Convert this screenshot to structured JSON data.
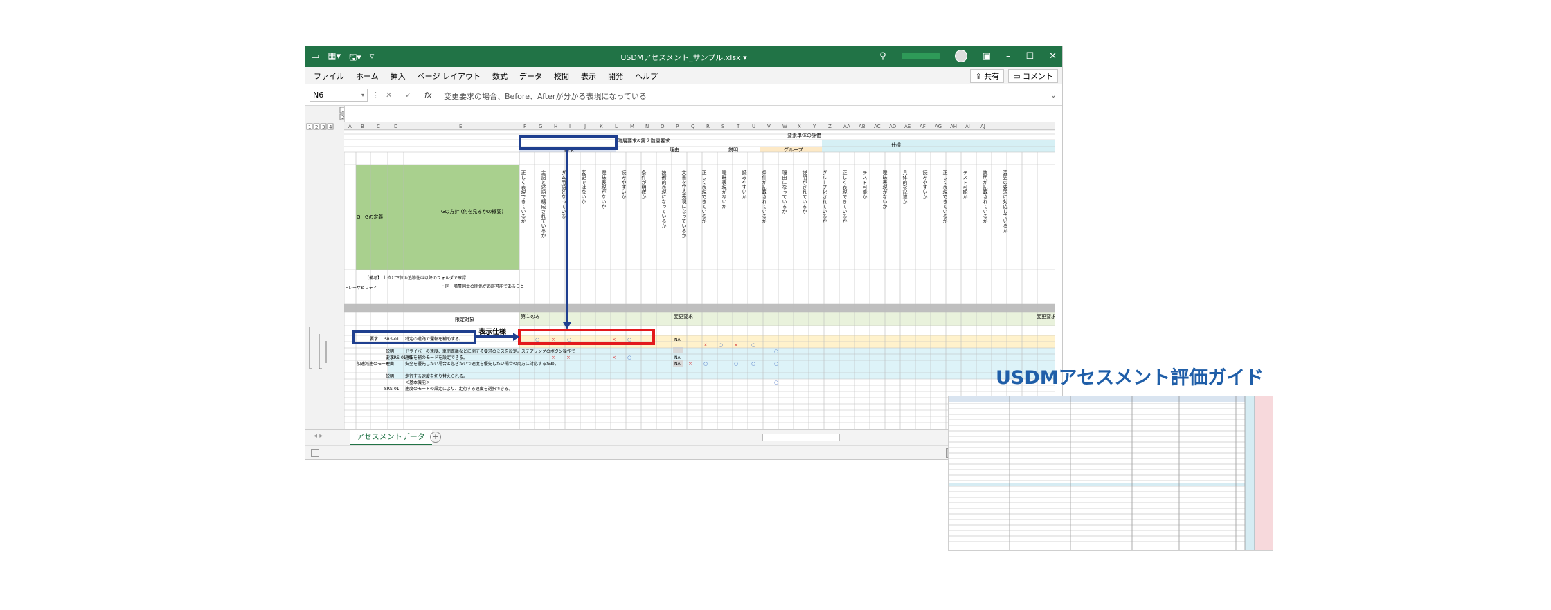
{
  "window": {
    "filename": "USDMアセスメント_サンプル.xlsx ▾"
  },
  "menu": {
    "items": [
      "ファイル",
      "ホーム",
      "挿入",
      "ページ レイアウト",
      "数式",
      "データ",
      "校閲",
      "表示",
      "開発",
      "ヘルプ"
    ],
    "share_label": "共有",
    "comment_label": "コメント"
  },
  "formula_bar": {
    "cell_ref": "N6",
    "fx": "fx",
    "content": "変更要求の場合、Before、Afterが分かる表現になっている"
  },
  "sheet": {
    "columns": [
      "A",
      "B",
      "C",
      "D",
      "E",
      "F",
      "G",
      "H",
      "I",
      "J",
      "K",
      "L",
      "M",
      "N",
      "O",
      "P",
      "Q",
      "R",
      "S",
      "T",
      "U",
      "V",
      "W",
      "X",
      "Y",
      "Z",
      "AA",
      "AB",
      "AC",
      "AD",
      "AE",
      "AF",
      "AG",
      "AH",
      "AI",
      "AJ"
    ],
    "header_top": "要素単体の評価",
    "header_group2": "階層要求&第２階層要求",
    "groups": [
      "要求",
      "理由",
      "説明",
      "グループ",
      "仕様"
    ],
    "col_g_label": "G",
    "col_g_def": "Gの定義",
    "col_g_method": "Gの方針\n(何を見るかの概要)",
    "row12_text": "トレーサビリティ",
    "row13_note": "【備考】\n上位と下位の追跡性は以降のフォルダで確認",
    "row13_right": "・同一階層同士の関係が追跡可能であること",
    "row15_label": "限定対象",
    "row15_f": "第１のみ",
    "row15_n": "変更要求",
    "row15_aj": "変更要求",
    "row16_title": "表示仕様",
    "row17_item": "要求",
    "row17_id": "SRS-01",
    "row17_text": "特定の道路で運転を補助する。",
    "row19_label": "説明",
    "row19_text": "ドライバーの速度、車間距離などに関する要求のミスを設定。ステアリングのボタン操作で",
    "row20_group": "加速減速のモード",
    "row20_item": "要求",
    "row20_id": "SRS-01-01",
    "row20_text": "運転を補のモードを設定できる。",
    "row21_item": "理由",
    "row21_text": "安全を優先したい場合と急ぎたいで速度を優先したい場合の両方に対応するため。",
    "row22_item": "説明",
    "row22_text": "走行する速度を切り替えられる。",
    "row23_text": "＜基本機能＞",
    "row24_id": "SRS-01-",
    "row24_text": "速度のモードの設定により、走行する速度を選択できる。",
    "na": "NA",
    "marks_circle": "○",
    "marks_cross": "×",
    "questions": [
      "正しく表現できているか",
      "主語と述語で構成されているか",
      "ダム用語となっている",
      "変更ではないか",
      "曖昧表現がないか",
      "読みやすいか",
      "条件が明確か",
      "技術的表現になっているか",
      "文書を守る表現になっているか",
      "正しく表現できているか",
      "曖昧表現がないか",
      "読みやすいか",
      "条件が記載されているか",
      "理由になっているか",
      "説明がされているか",
      "グループ化されているか",
      "正しく表現できているか",
      "テスト可能か",
      "曖昧表現がないか",
      "具体的な記述か",
      "読みやすいか",
      "正しく表現できているか",
      "テスト可能か",
      "説明が記載されているか",
      "変更の要求に対応しているか"
    ]
  },
  "sheet_tab": "アセスメントデータ",
  "guide": {
    "title": "USDMアセスメント評価ガイド"
  },
  "colors": {
    "excel_green": "#217346",
    "header_green": "#a9d08e",
    "blue_box": "#1f3f8f",
    "red_box": "#e3191c",
    "yellow_row": "#fff2cc",
    "cyan_row": "#ddf3f8",
    "gray_row": "#bfbfbf",
    "guide_blue": "#1f5ea8"
  }
}
